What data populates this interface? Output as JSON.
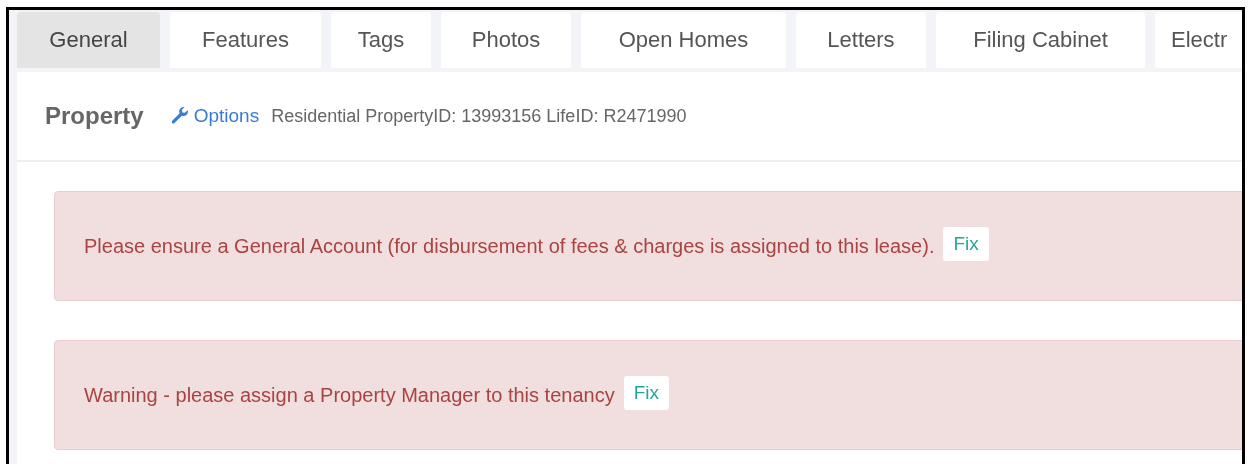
{
  "tabs": [
    {
      "label": "General",
      "selected": true
    },
    {
      "label": "Features",
      "selected": false
    },
    {
      "label": "Tags",
      "selected": false
    },
    {
      "label": "Photos",
      "selected": false
    },
    {
      "label": "Open Homes",
      "selected": false
    },
    {
      "label": "Letters",
      "selected": false
    },
    {
      "label": "Filing Cabinet",
      "selected": false
    },
    {
      "label": "Electr",
      "selected": false
    }
  ],
  "header": {
    "title": "Property",
    "options_link": "Options",
    "info": "Residential PropertyID: 13993156 LifeID: R2471990"
  },
  "alerts": [
    {
      "message": "Please ensure a General Account (for disbursement of fees & charges is assigned to this lease).",
      "action": "Fix"
    },
    {
      "message": "Warning - please assign a Property Manager to this tenancy",
      "action": "Fix"
    }
  ]
}
